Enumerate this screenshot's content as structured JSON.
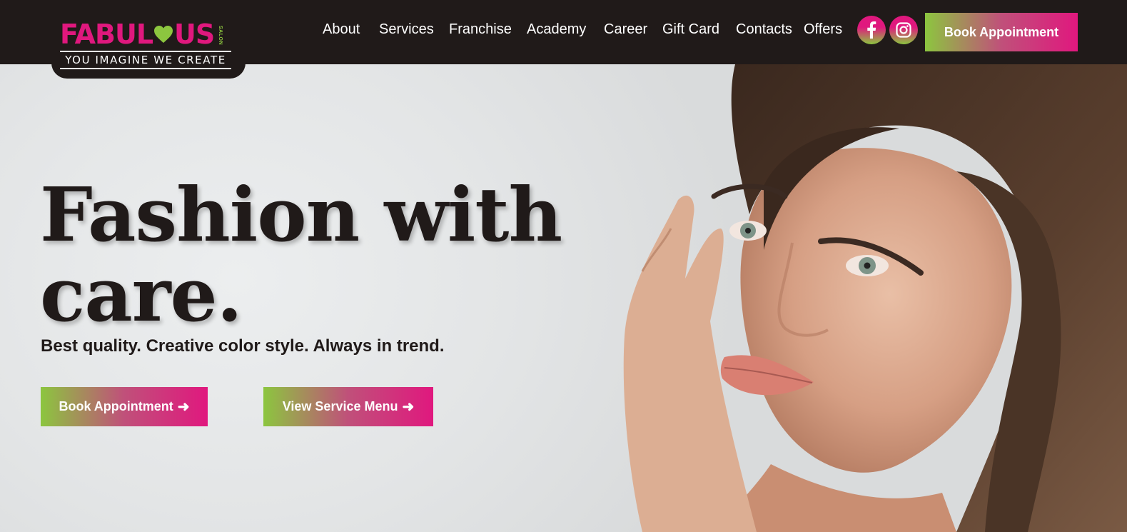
{
  "brand": {
    "name_left": "FABUL",
    "name_right": "US",
    "salon_label": "SALON",
    "tagline": "YOU IMAGINE WE CREATE",
    "pink": "#e0187e",
    "green": "#8cc63f"
  },
  "nav": {
    "items": [
      {
        "label": "About"
      },
      {
        "label": "Services"
      },
      {
        "label": "Franchise"
      },
      {
        "label": "Academy"
      },
      {
        "label": "Career"
      },
      {
        "label": "Gift Card"
      },
      {
        "label": "Contacts"
      },
      {
        "label": "Offers"
      }
    ],
    "social": [
      {
        "icon": "facebook-icon"
      },
      {
        "icon": "instagram-icon"
      }
    ],
    "cta_label": "Book Appointment"
  },
  "hero": {
    "title_line1": "Fashion with",
    "title_line2": "care.",
    "subtitle": "Best quality. Creative color style. Always in trend.",
    "primary_button": "Book Appointment",
    "secondary_button": "View Service Menu",
    "image_subject": "woman-portrait"
  },
  "colors": {
    "header_bg": "#201a19",
    "text_dark": "#201a19"
  }
}
